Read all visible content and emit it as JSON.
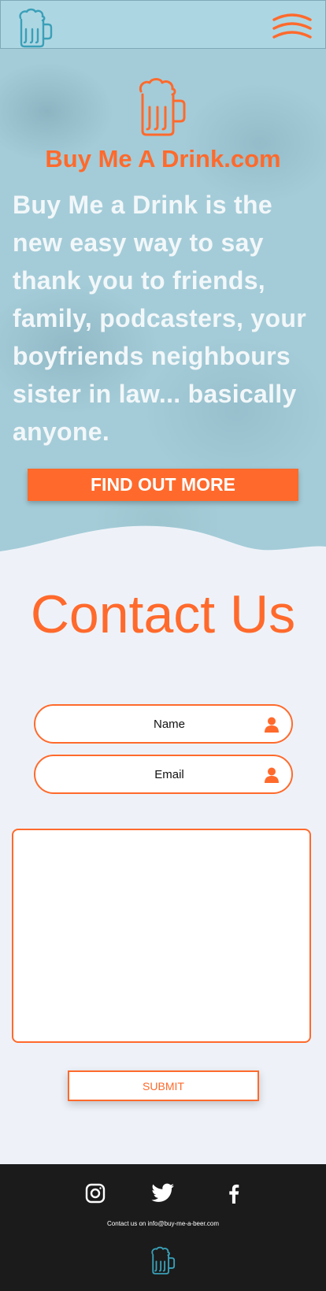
{
  "header": {
    "logo_icon": "beer-mug-icon",
    "menu_icon": "hamburger-menu-icon",
    "accent_color": "#ff6a2c",
    "logo_color": "#3aa0b8"
  },
  "hero": {
    "mug_icon": "beer-mug-icon",
    "brand": "Buy Me A Drink.com",
    "tagline": "Buy Me a Drink is the new easy way to say thank you to friends, family, podcasters, your boyfriends neighbours sister in law... basically anyone.",
    "cta_label": "FIND OUT MORE"
  },
  "contact": {
    "title": "Contact Us",
    "name_placeholder": "Name",
    "email_placeholder": "Email",
    "field_icon": "user-icon",
    "message_placeholder": "",
    "submit_label": "SUBMIT"
  },
  "footer": {
    "social_icons": [
      "instagram-icon",
      "twitter-icon",
      "facebook-icon"
    ],
    "contact_line": "Contact us on info@buy-me-a-beer.com",
    "logo_icon": "beer-mug-icon"
  }
}
